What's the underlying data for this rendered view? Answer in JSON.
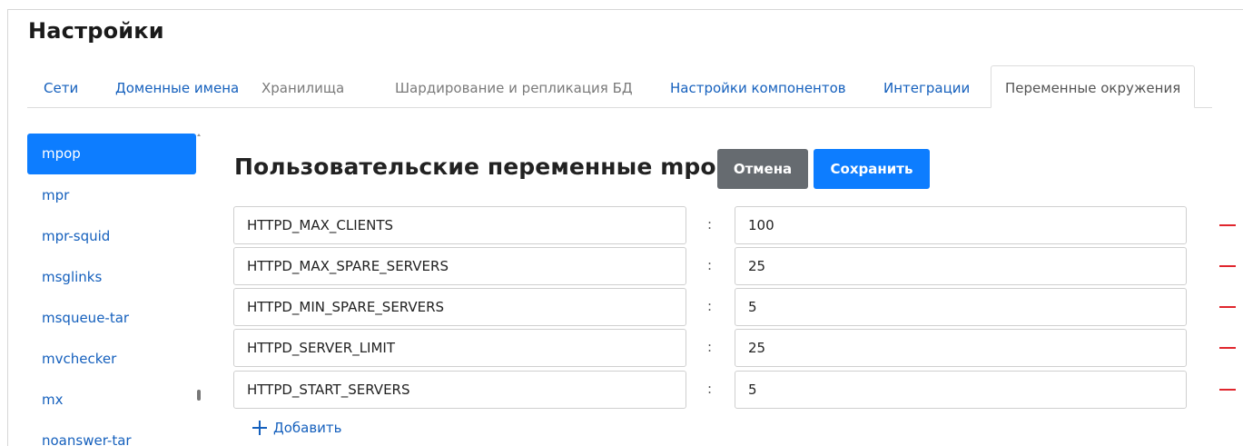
{
  "page": {
    "title": "Настройки"
  },
  "tabs": [
    {
      "label": "Сети"
    },
    {
      "label": "Доменные имена"
    },
    {
      "label": "Хранилища"
    },
    {
      "label": "Шардирование и репликация БД"
    },
    {
      "label": "Настройки компонентов"
    },
    {
      "label": "Интеграции"
    },
    {
      "label": "Переменные окружения"
    }
  ],
  "active_tab": "Переменные окружения",
  "sidebar": {
    "items": [
      {
        "label": "mpop"
      },
      {
        "label": "mpr"
      },
      {
        "label": "mpr-squid"
      },
      {
        "label": "msglinks"
      },
      {
        "label": "msqueue-tar"
      },
      {
        "label": "mvchecker"
      },
      {
        "label": "mx"
      },
      {
        "label": "noanswer-tar"
      }
    ],
    "active": "mpop"
  },
  "section": {
    "heading": "Пользовательские переменные mpop:",
    "cancel_label": "Отмена",
    "save_label": "Сохранить",
    "add_label": "Добавить",
    "separator": ":"
  },
  "variables": [
    {
      "key": "HTTPD_MAX_CLIENTS",
      "value": "100"
    },
    {
      "key": "HTTPD_MAX_SPARE_SERVERS",
      "value": "25"
    },
    {
      "key": "HTTPD_MIN_SPARE_SERVERS",
      "value": "5"
    },
    {
      "key": "HTTPD_SERVER_LIMIT",
      "value": "25"
    },
    {
      "key": "HTTPD_START_SERVERS",
      "value": "5"
    }
  ],
  "colors": {
    "accent": "#0d7dff",
    "link": "#1560bd",
    "cancel": "#666b70",
    "remove": "#e0262d"
  },
  "icons": {
    "add": "plus-icon",
    "remove": "minus-icon"
  }
}
